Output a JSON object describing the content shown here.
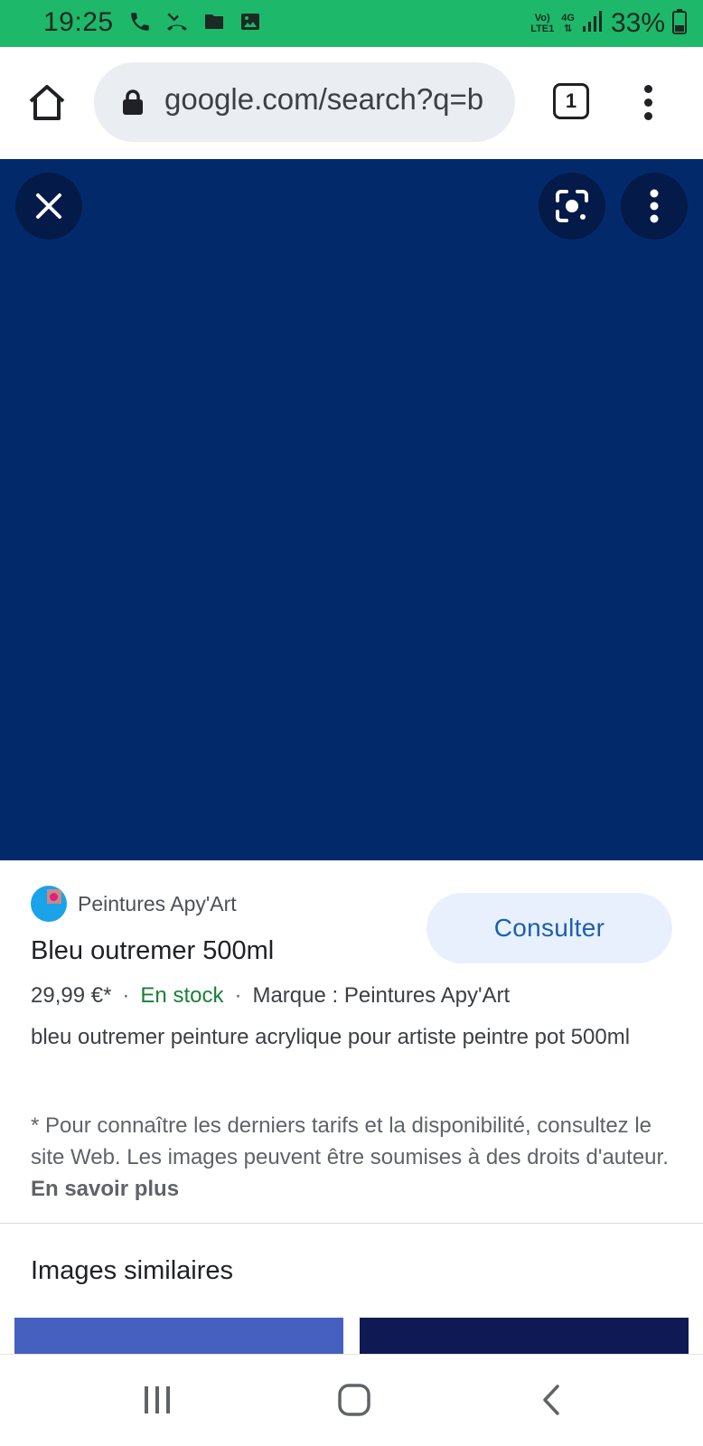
{
  "status_bar": {
    "time": "19:25",
    "volte_top": "Vo)",
    "volte_bottom": "LTE1",
    "network": "4G",
    "battery": "33%"
  },
  "browser": {
    "url": "google.com/search?q=b",
    "tab_count": "1"
  },
  "product": {
    "source": "Peintures Apy'Art",
    "action_label": "Consulter",
    "title": "Bleu outremer 500ml",
    "price": "29,99 €*",
    "availability": "En stock",
    "brand": "Marque : Peintures Apy'Art",
    "description": "bleu outremer peinture acrylique pour artiste peintre pot 500ml",
    "notice": "* Pour connaître les derniers tarifs et la disponibilité, consultez le site Web. Les images peuvent être soumises à des droits d'auteur.",
    "notice_link": "En savoir plus"
  },
  "similar": {
    "title": "Images similaires"
  },
  "colors": {
    "status_bar": "#1db86a",
    "image": "#022a6b",
    "accent": "#1a5fb4",
    "in_stock": "#188038"
  },
  "icons": {
    "status": [
      "phone-icon",
      "missed-call-icon",
      "folder-icon",
      "image-icon",
      "signal-icon",
      "battery-icon"
    ],
    "toolbar": [
      "home-icon",
      "lock-icon",
      "tabs-icon",
      "more-vert-icon"
    ],
    "viewer": [
      "close-icon",
      "lens-icon",
      "more-vert-icon"
    ],
    "nav": [
      "recents-icon",
      "home-icon",
      "back-icon"
    ]
  }
}
